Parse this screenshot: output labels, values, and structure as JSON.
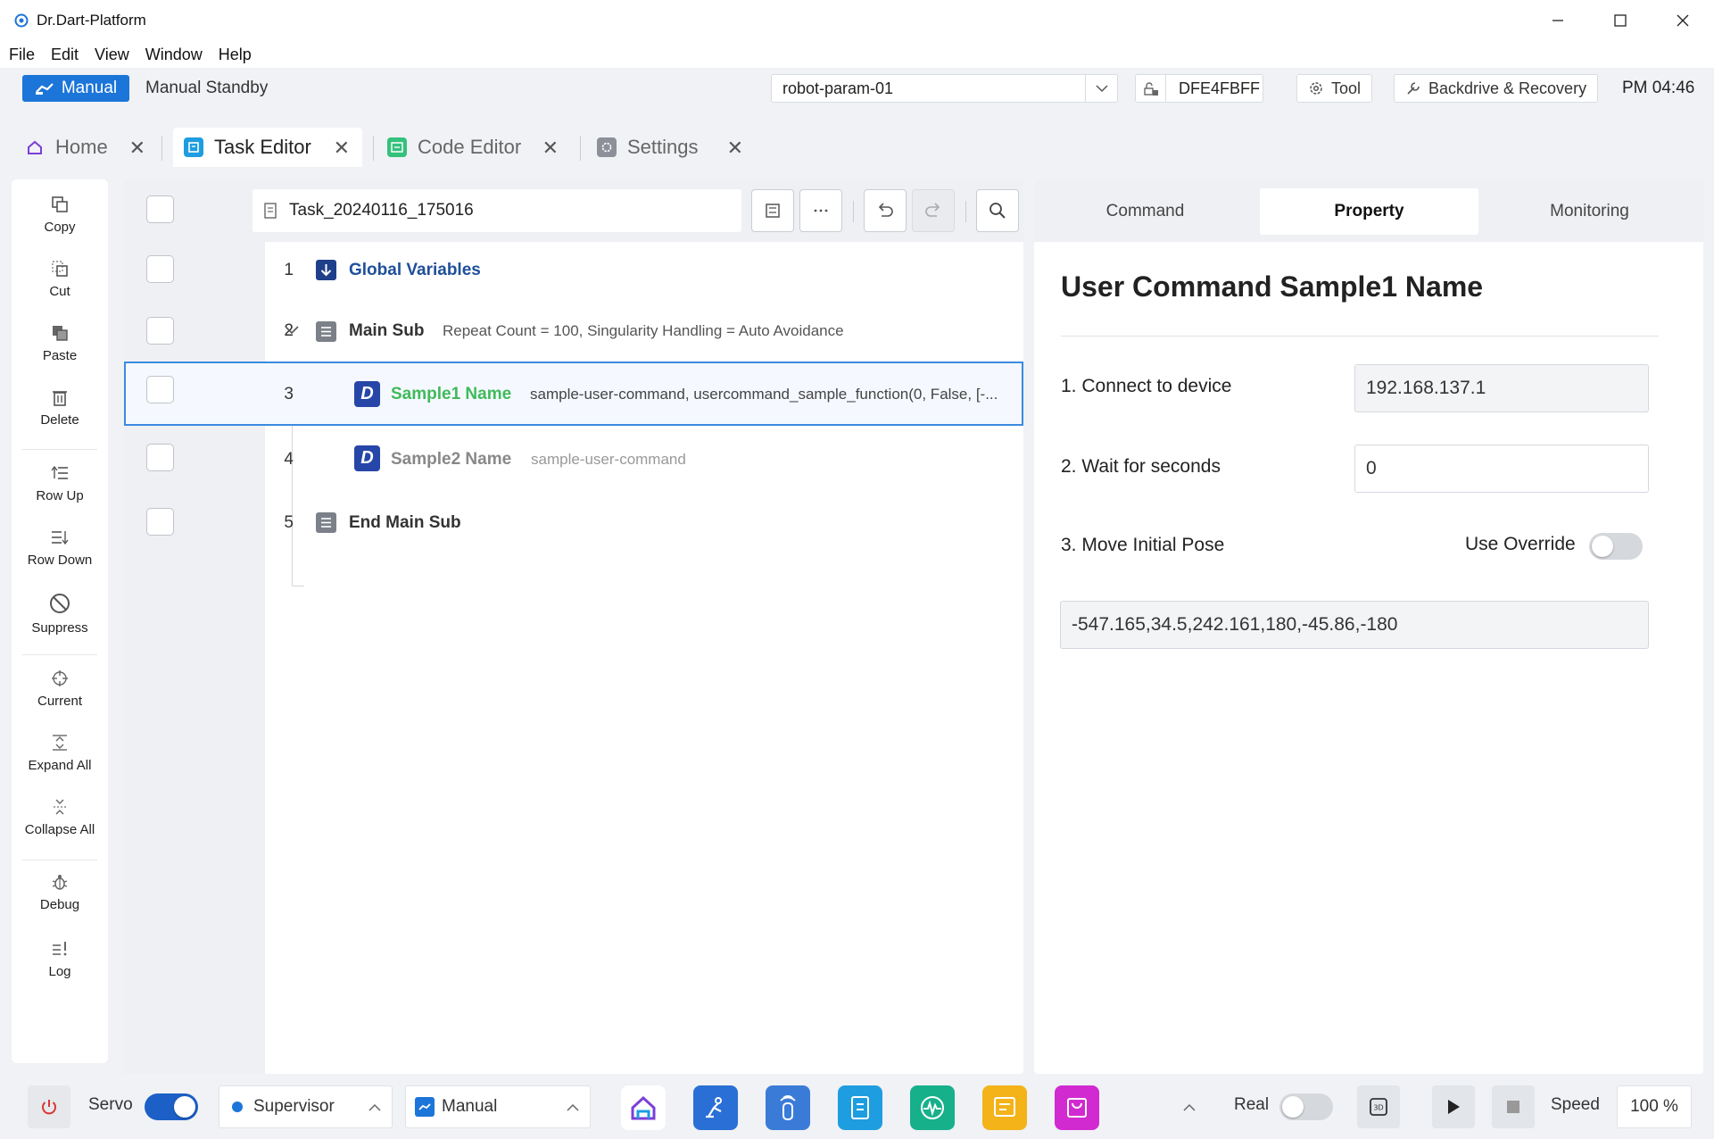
{
  "window": {
    "title": "Dr.Dart-Platform"
  },
  "menu": [
    "File",
    "Edit",
    "View",
    "Window",
    "Help"
  ],
  "status": {
    "mode": "Manual",
    "standby": "Manual Standby",
    "robot_param": "robot-param-01",
    "device_id": "DFE4FBFF",
    "tool_label": "Tool",
    "backdrive_label": "Backdrive & Recovery",
    "clock": "PM 04:46"
  },
  "tabs": [
    {
      "label": "Home",
      "active": false
    },
    {
      "label": "Task Editor",
      "active": true
    },
    {
      "label": "Code Editor",
      "active": false
    },
    {
      "label": "Settings",
      "active": false
    }
  ],
  "toolbar": [
    "Copy",
    "Cut",
    "Paste",
    "Delete",
    "Row Up",
    "Row Down",
    "Suppress",
    "Current",
    "Expand All",
    "Collapse All",
    "Debug",
    "Log"
  ],
  "editor": {
    "task_name": "Task_20240116_175016",
    "rows": [
      {
        "num": "1",
        "title": "Global Variables",
        "detail": ""
      },
      {
        "num": "2",
        "title": "Main Sub",
        "detail": "Repeat Count = 100, Singularity Handling = Auto Avoidance"
      },
      {
        "num": "3",
        "title": "Sample1 Name",
        "detail": "sample-user-command, usercommand_sample_function(0, False, [-..."
      },
      {
        "num": "4",
        "title": "Sample2 Name",
        "detail": "sample-user-command"
      },
      {
        "num": "5",
        "title": "End Main Sub",
        "detail": ""
      }
    ]
  },
  "panel": {
    "tabs": [
      "Command",
      "Property",
      "Monitoring"
    ],
    "active_tab": "Property",
    "title": "User Command Sample1 Name",
    "fields": [
      {
        "label": "1. Connect to device",
        "value": "192.168.137.1"
      },
      {
        "label": "2. Wait for seconds",
        "value": "0"
      },
      {
        "label": "3. Move Initial Pose",
        "value": "-547.165,34.5,242.161,180,-45.86,-180"
      }
    ],
    "override_label": "Use Override",
    "override_on": false
  },
  "bottom": {
    "servo_label": "Servo",
    "servo_on": true,
    "role": "Supervisor",
    "mode": "Manual",
    "real_label": "Real",
    "real_on": false,
    "speed_label": "Speed",
    "speed_value": "100 %"
  },
  "colors": {
    "accent": "#1c75d8",
    "selected_row": "#3b8be0",
    "green_title": "#3fba5a",
    "navy": "#1f3f8a"
  }
}
